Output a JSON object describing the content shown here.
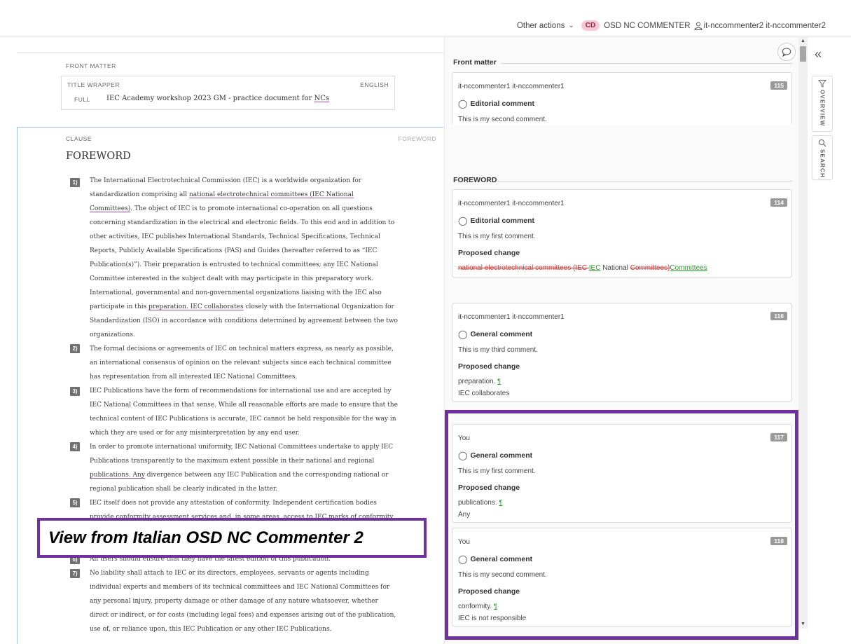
{
  "topbar": {
    "other_actions": "Other actions",
    "role_badge": "CD",
    "role_label": "OSD NC COMMENTER",
    "user_name": "it-nccommenter2 it-nccommenter2"
  },
  "document": {
    "front_matter_label": "FRONT MATTER",
    "title_wrapper": {
      "label": "TITLE WRAPPER",
      "language": "ENGLISH",
      "full_label": "FULL",
      "title_main": "IEC Academy workshop 2023 GM - practice document for ",
      "title_ncs": "NCs"
    },
    "clause_label": "CLAUSE",
    "clause_tag": "FOREWORD",
    "heading": "FOREWORD",
    "paragraphs": [
      {
        "num": "1)",
        "a": "The International Electrotechnical Commission (IEC) is a worldwide organization for standardization comprising all ",
        "b": "national electrotechnical committees (IEC National Committees)",
        "c": ". The object of IEC is to promote international co-operation on all questions concerning standardization in the electrical and electronic fields. To this end and in addition to other activities, IEC publishes International Standards, Technical Specifications, Technical Reports, Publicly Available Specifications (PAS) and Guides (hereafter referred to as “IEC Publication(s)”). Their preparation is entrusted to technical committees; any IEC National Committee interested in the subject dealt with may participate in this preparatory work. International, governmental and non-governmental organizations liaising with the IEC also participate in this ",
        "d": "preparation. IEC collaborates",
        "e": " closely with the International Organization for Standardization (ISO) in accordance with conditions determined by agreement between the two organizations."
      },
      {
        "num": "2)",
        "text": "The formal decisions or agreements of IEC on technical matters express, as nearly as possible, an international consensus of opinion on the relevant subjects since each technical committee has representation from all interested IEC National Committees."
      },
      {
        "num": "3)",
        "text": "IEC Publications have the form of recommendations for international use and are accepted by IEC National Committees in that sense. While all reasonable efforts are made to ensure that the technical content of IEC Publications is accurate, IEC cannot be held responsible for the way in which they are used or for any misinterpretation by any end user."
      },
      {
        "num": "4)",
        "a": "In order to promote international uniformity, IEC National Committees undertake to apply IEC Publications transparently to the maximum extent possible in their national and regional ",
        "b": "publications. Any",
        "c": " divergence between any IEC Publication and the corresponding national or regional publication shall be clearly indicated in the latter."
      },
      {
        "num": "5)",
        "text": "IEC itself does not provide any attestation of conformity. Independent certification bodies provide conformity assessment services and, in some areas, access to IEC marks of conformity. IEC is not responsible for any services carried out by independent certification bodies."
      },
      {
        "num": "6)",
        "text": "All users should ensure that they have the latest edition of this publication."
      },
      {
        "num": "7)",
        "text": "No liability shall attach to IEC or its directors, employees, servants or agents including individual experts and members of its technical committees and IEC National Committees for any personal injury, property damage or other damage of any nature whatsoever, whether direct or indirect, or for costs (including legal fees) and expenses arising out of the publication, use of, or reliance upon, this IEC Publication or any other IEC Publications."
      }
    ]
  },
  "overlay_banner": "View from Italian OSD NC Commenter 2",
  "panel": {
    "front_matter_heading": "Front matter",
    "foreword_heading": "FOREWORD",
    "cards": [
      {
        "author": "it-nccommenter1 it-nccommenter1",
        "number": "115",
        "type": "Editorial comment",
        "text": "This is my second comment."
      },
      {
        "author": "it-nccommenter1 it-nccommenter1",
        "number": "114",
        "type": "Editorial comment",
        "text": "This is my first comment.",
        "proposed_label": "Proposed change",
        "del1": "national electrotechnical committees (IEC ",
        "ins1": "IEC",
        "mid": " National ",
        "del2": "Committees)",
        "ins2": "Committees"
      },
      {
        "author": "it-nccommenter1 it-nccommenter1",
        "number": "116",
        "type": "General comment",
        "text": "This is my third comment.",
        "proposed_label": "Proposed change",
        "line1": "preparation. ",
        "line2": "IEC collaborates"
      },
      {
        "author": "You",
        "number": "117",
        "type": "General comment",
        "text": "This is my first comment.",
        "proposed_label": "Proposed change",
        "line1": "publications. ",
        "line2": "Any"
      },
      {
        "author": "You",
        "number": "118",
        "type": "General comment",
        "text": "This is my second comment.",
        "proposed_label": "Proposed change",
        "line1": "conformity. ",
        "line2": "IEC is not responsible"
      }
    ],
    "paragraph_mark": "¶"
  },
  "rail": {
    "collapse": "«",
    "overview": "OVERVIEW",
    "search": "SEARCH"
  },
  "colors": {
    "accent_purple": "#7030a0",
    "delete_red": "#d93030",
    "insert_green": "#2e9a2e",
    "clause_border": "#9dc3e6"
  }
}
